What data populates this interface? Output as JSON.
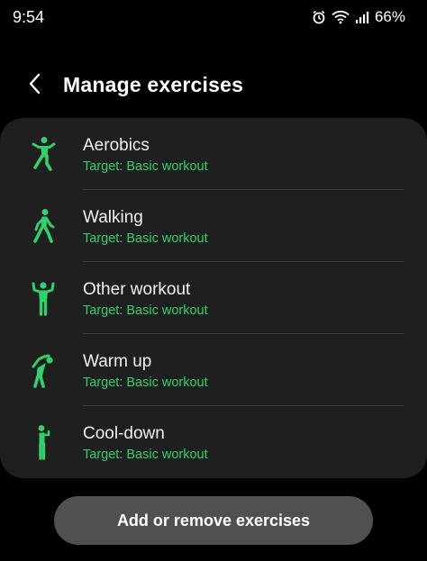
{
  "status_bar": {
    "time": "9:54",
    "battery": "66%",
    "icons": [
      "alarm-icon",
      "wifi-icon",
      "signal-icon"
    ]
  },
  "header": {
    "title": "Manage exercises",
    "back_icon": "chevron-left-icon"
  },
  "exercises": [
    {
      "label": "Aerobics",
      "target": "Target: Basic workout",
      "icon": "aerobics-icon"
    },
    {
      "label": "Walking",
      "target": "Target: Basic workout",
      "icon": "walking-icon"
    },
    {
      "label": "Other workout",
      "target": "Target: Basic workout",
      "icon": "other-workout-icon"
    },
    {
      "label": "Warm up",
      "target": "Target: Basic workout",
      "icon": "warm-up-icon"
    },
    {
      "label": "Cool-down",
      "target": "Target: Basic workout",
      "icon": "cool-down-icon"
    }
  ],
  "action_button": {
    "label": "Add or remove exercises"
  },
  "colors": {
    "accent": "#2fd16a",
    "background": "#000000",
    "card": "#1f1f1f",
    "button": "#505050"
  }
}
